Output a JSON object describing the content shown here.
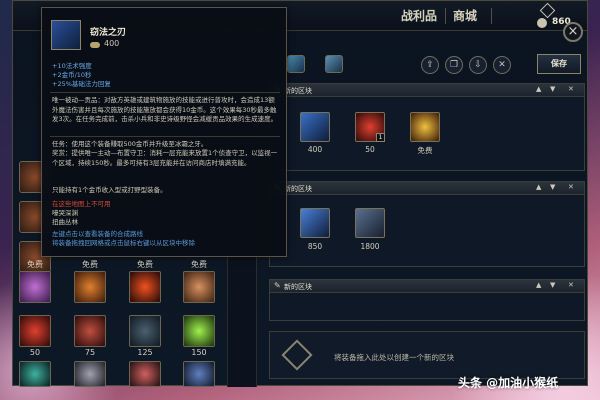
{
  "topbar": {
    "tabs": [
      {
        "label": "战利品"
      },
      {
        "label": "商城"
      }
    ],
    "blue_essence": "",
    "riot_points": "860",
    "close_label": "×"
  },
  "tooltip": {
    "item_name": "窃法之刃",
    "cost": "400",
    "stats": [
      "+10法术强度",
      "+2金币/10秒",
      "+25%基础法力回复"
    ],
    "passive_1": "唯一被动—贡品：对敌方英雄或建筑物施放的技能或进行普攻时，会造成13额外魔法伤害并且每次施放的技能施放都会获得10金币。这个效果每30秒最多触发3次。在任务完成前，击杀小兵和非史诗级野怪会减缓贡品效果的生成速度。",
    "quest": "任务：使用这个装备赚取500金币并升级至冰霜之牙。",
    "active": "奖赏：提供唯一主动—布置守卫：消耗一层充能来放置1个侦查守卫，以监视一个区域，持续150秒。最多可持有3层充能并在访问商店时填满充能。",
    "limit": "只能持有1个金币收入型或打野型装备。",
    "warn": "在这些地图上不可用",
    "maps": [
      "嚎哭深渊",
      "扭曲丛林"
    ],
    "hint": "左键点击以查看装备的合成路线\n将装备拖拽回网格或点击鼠标右键以从区块中移除"
  },
  "left_grid": {
    "free_label": "免费",
    "row_prices": [
      "50",
      "75",
      "125",
      "150"
    ]
  },
  "right_panel": {
    "save_label": "保存",
    "blocks": [
      {
        "title": "新的区块",
        "items": [
          {
            "price": "400"
          },
          {
            "price": "50",
            "badge": "1"
          },
          {
            "price": "免费"
          }
        ]
      },
      {
        "title": "新的区块",
        "items": [
          {
            "price": "850"
          },
          {
            "price": "1800"
          }
        ]
      },
      {
        "title": "新的区块",
        "items": []
      }
    ],
    "drop_text": "将装备拖入此处以创建一个新的区块"
  },
  "watermark": "头条 @加油小猴纸"
}
